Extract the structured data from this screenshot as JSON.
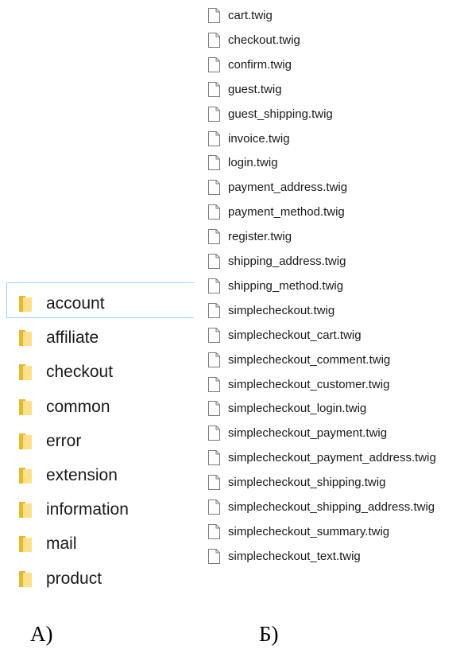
{
  "folders": {
    "selected": "account",
    "items": [
      {
        "label": "account",
        "icon": "folder-icon"
      },
      {
        "label": "affiliate",
        "icon": "folder-icon"
      },
      {
        "label": "checkout",
        "icon": "folder-icon"
      },
      {
        "label": "common",
        "icon": "folder-icon"
      },
      {
        "label": "error",
        "icon": "folder-icon"
      },
      {
        "label": "extension",
        "icon": "folder-icon"
      },
      {
        "label": "information",
        "icon": "folder-icon"
      },
      {
        "label": "mail",
        "icon": "folder-icon"
      },
      {
        "label": "product",
        "icon": "folder-icon"
      }
    ]
  },
  "files": {
    "items": [
      {
        "label": "cart.twig",
        "icon": "file-icon"
      },
      {
        "label": "checkout.twig",
        "icon": "file-icon"
      },
      {
        "label": "confirm.twig",
        "icon": "file-icon"
      },
      {
        "label": "guest.twig",
        "icon": "file-icon"
      },
      {
        "label": "guest_shipping.twig",
        "icon": "file-icon"
      },
      {
        "label": "invoice.twig",
        "icon": "file-icon"
      },
      {
        "label": "login.twig",
        "icon": "file-icon"
      },
      {
        "label": "payment_address.twig",
        "icon": "file-icon"
      },
      {
        "label": "payment_method.twig",
        "icon": "file-icon"
      },
      {
        "label": "register.twig",
        "icon": "file-icon"
      },
      {
        "label": "shipping_address.twig",
        "icon": "file-icon"
      },
      {
        "label": "shipping_method.twig",
        "icon": "file-icon"
      },
      {
        "label": "simplecheckout.twig",
        "icon": "file-icon"
      },
      {
        "label": "simplecheckout_cart.twig",
        "icon": "file-icon"
      },
      {
        "label": "simplecheckout_comment.twig",
        "icon": "file-icon"
      },
      {
        "label": "simplecheckout_customer.twig",
        "icon": "file-icon"
      },
      {
        "label": "simplecheckout_login.twig",
        "icon": "file-icon"
      },
      {
        "label": "simplecheckout_payment.twig",
        "icon": "file-icon"
      },
      {
        "label": "simplecheckout_payment_address.twig",
        "icon": "file-icon"
      },
      {
        "label": "simplecheckout_shipping.twig",
        "icon": "file-icon"
      },
      {
        "label": "simplecheckout_shipping_address.twig",
        "icon": "file-icon"
      },
      {
        "label": "simplecheckout_summary.twig",
        "icon": "file-icon"
      },
      {
        "label": "simplecheckout_text.twig",
        "icon": "file-icon"
      }
    ]
  },
  "captions": {
    "a": "A)",
    "b": "Б)"
  },
  "colors": {
    "folder_light": "#ffe08a",
    "folder_dark": "#e6b82e",
    "file_border": "#7a7a7a",
    "selection_border": "#99d1ff"
  }
}
